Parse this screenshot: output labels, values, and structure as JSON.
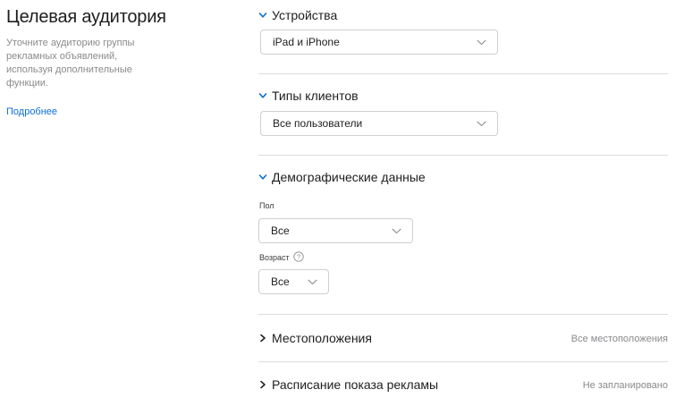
{
  "left": {
    "title": "Целевая аудитория",
    "description": "Уточните аудиторию группы рекламных объявлений, используя дополнительные функции.",
    "learn_more": "Подробнее"
  },
  "sections": {
    "devices": {
      "title": "Устройства",
      "select_value": "iPad и iPhone"
    },
    "customer_types": {
      "title": "Типы клиентов",
      "select_value": "Все пользователи"
    },
    "demographics": {
      "title": "Демографические данные",
      "gender_label": "Пол",
      "gender_value": "Все",
      "age_label": "Возраст",
      "age_value": "Все"
    },
    "locations": {
      "title": "Местоположения",
      "summary": "Все местоположения"
    },
    "ad_schedule": {
      "title": "Расписание показа рекламы",
      "summary": "Не запланировано"
    }
  },
  "colors": {
    "accent": "#0a6fd8",
    "chevron_open": "#0a6fd8",
    "divider": "#dcdcdf"
  },
  "icons": [
    "chevron-down-icon",
    "chevron-right-icon",
    "help-circle-icon",
    "dropdown-arrow-icon"
  ]
}
